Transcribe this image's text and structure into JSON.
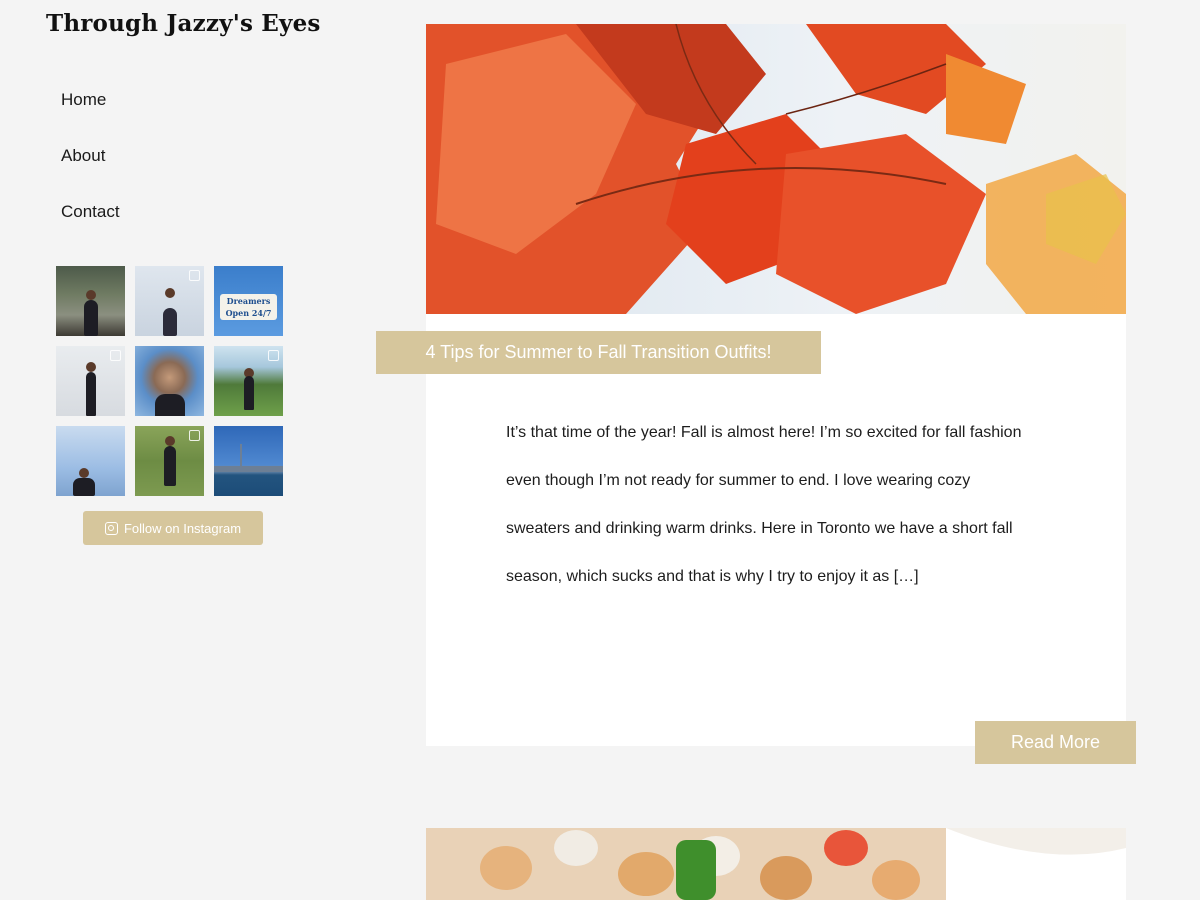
{
  "site": {
    "title": "Through Jazzy's Eyes"
  },
  "nav": {
    "items": [
      {
        "label": "Home"
      },
      {
        "label": "About"
      },
      {
        "label": "Contact"
      }
    ]
  },
  "instagram": {
    "follow_label": "Follow on Instagram",
    "thumbs": [
      {
        "icon": "photo"
      },
      {
        "icon": "gallery-icon"
      },
      {
        "icon": "photo",
        "sign_line1": "Dreamers",
        "sign_line2": "Open 24/7"
      },
      {
        "icon": "gallery-icon"
      },
      {
        "icon": "photo"
      },
      {
        "icon": "gallery-icon"
      },
      {
        "icon": "photo"
      },
      {
        "icon": "gallery-icon"
      },
      {
        "icon": "photo"
      }
    ]
  },
  "post": {
    "title": "4 Tips for Summer to Fall Transition Outfits!",
    "excerpt": "It’s that time of the year! Fall is almost here!  I’m so excited for fall fashion even though I’m not ready for summer to end. I love wearing cozy sweaters and drinking warm drinks. Here in Toronto we have a short fall season, which sucks and that is why I try to enjoy it as […]",
    "read_more_label": "Read More"
  },
  "colors": {
    "accent": "#d6c69c",
    "background": "#f4f4f4",
    "card": "#ffffff",
    "text": "#1d1d1d"
  }
}
